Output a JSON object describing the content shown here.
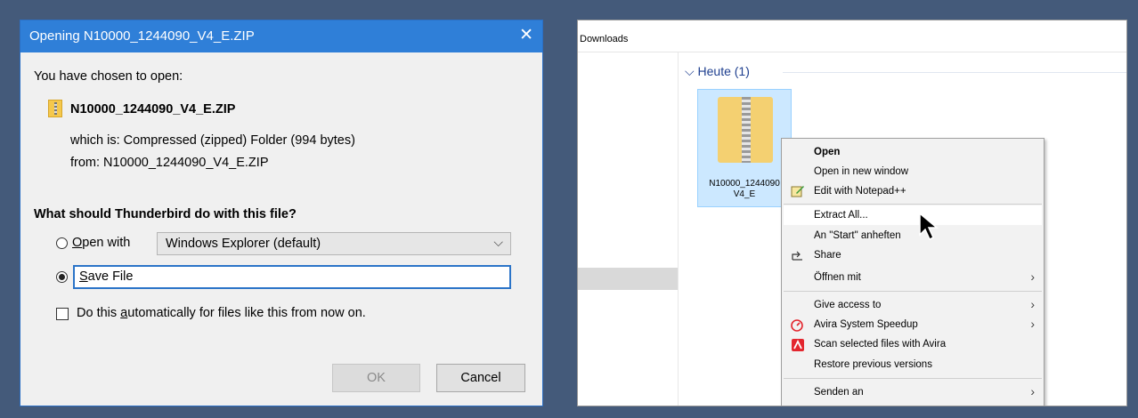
{
  "dialog": {
    "title": "Opening N10000_1244090_V4_E.ZIP",
    "chosen_label": "You have chosen to open:",
    "filename": "N10000_1244090_V4_E.ZIP",
    "which_is": "which is:  Compressed (zipped) Folder (994 bytes)",
    "from": "from:  N10000_1244090_V4_E.ZIP",
    "question": "What should Thunderbird do with this file?",
    "open_with_label_pre": "",
    "open_with_label_u": "O",
    "open_with_label_post": "pen with",
    "open_with_value": "Windows Explorer (default)",
    "save_label_u": "S",
    "save_label_post": "ave File",
    "auto_pre": "Do this ",
    "auto_u": "a",
    "auto_post": "utomatically for files like this from now on.",
    "ok": "OK",
    "cancel": "Cancel",
    "selected_option": "Save File"
  },
  "explorer": {
    "path": "Downloads",
    "group": "Heute (1)",
    "file_label_line1": "N10000_1244090",
    "file_label_line2": "V4_E",
    "menu": {
      "open": "Open",
      "open_new_window": "Open in new window",
      "edit_notepad": "Edit with Notepad++",
      "extract_all": "Extract All...",
      "pin_start": "An \"Start\" anheften",
      "share": "Share",
      "open_with": "Öffnen mit",
      "give_access": "Give access to",
      "avira_speedup": "Avira System Speedup",
      "avira_scan": "Scan selected files with Avira",
      "restore": "Restore previous versions",
      "send_to": "Senden an"
    }
  },
  "colors": {
    "background": "#445a7a",
    "titlebar": "#2f7fd8",
    "selection": "#cce8ff",
    "avira": "#e3262e"
  }
}
